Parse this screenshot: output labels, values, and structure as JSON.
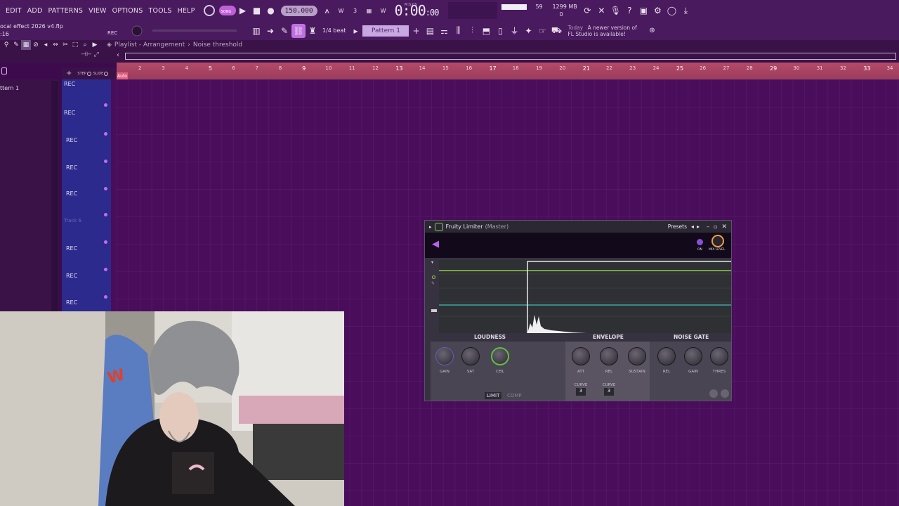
{
  "menu": [
    "EDIT",
    "ADD",
    "PATTERNS",
    "VIEW",
    "OPTIONS",
    "TOOLS",
    "HELP"
  ],
  "transport": {
    "song_mode": "SONG",
    "tempo": "150.000",
    "time": "0:00",
    "time_small": ":00",
    "time_unit": "M:S:CS"
  },
  "meter": {
    "value": "59",
    "memory": "1299 MB",
    "zero": "0"
  },
  "project": {
    "name": "ocal effect 2026 v4.flp",
    "sub": ":16",
    "rec": "REC"
  },
  "toolbar2": {
    "snap": "1/4 beat",
    "pattern": "Pattern 1"
  },
  "notice": {
    "today": "Today",
    "line1": "A newer version of",
    "line2": "FL Studio is available!"
  },
  "playlist": {
    "breadcrumb_1": "Playlist - Arrangement",
    "breadcrumb_2": "Noise threshold",
    "step": "STEP",
    "slide": "SLIDE",
    "auto": "Auto"
  },
  "left_panel": {
    "pattern": "ttern 1"
  },
  "tracks": [
    "REC",
    "REC",
    "REC",
    "REC",
    "REC",
    "Track 6",
    "REC",
    "REC",
    "REC"
  ],
  "ruler": [
    "2",
    "3",
    "4",
    "5",
    "6",
    "7",
    "8",
    "9",
    "10",
    "11",
    "12",
    "13",
    "14",
    "15",
    "16",
    "17",
    "18",
    "19",
    "20",
    "21",
    "22",
    "23",
    "24",
    "25",
    "26",
    "27",
    "28",
    "29",
    "30",
    "31",
    "32",
    "33",
    "34"
  ],
  "plugin": {
    "title": "Fruity Limiter",
    "context": "(Master)",
    "presets": "Presets",
    "on_label": "ON",
    "mix_label": "MIX LEVEL",
    "sections": [
      "LOUDNESS",
      "ENVELOPE",
      "NOISE GATE"
    ],
    "knobs": [
      "GAIN",
      "SAT",
      "CEIL",
      "ATT",
      "REL",
      "SUSTAIN",
      "REL",
      "GAIN",
      "THRES"
    ],
    "curve_label": "CURVE",
    "curve_values": [
      "3",
      "3"
    ],
    "modes": [
      "LIMIT",
      "COMP"
    ],
    "colors": {
      "threshold_line": "#8fce4a",
      "ceiling_line": "#3aa6a8",
      "accent": "#8a4fd8"
    }
  }
}
